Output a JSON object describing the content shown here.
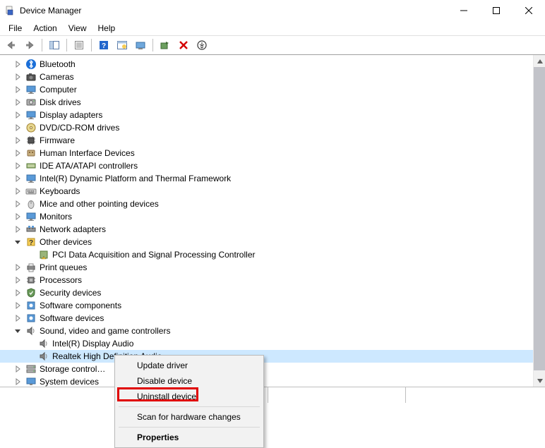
{
  "window": {
    "title": "Device Manager"
  },
  "menubar": {
    "file": "File",
    "action": "Action",
    "view": "View",
    "help": "Help"
  },
  "toolbar": {
    "back": "back",
    "forward": "forward",
    "show_hide": "show-hide-tree",
    "properties": "properties",
    "help": "help",
    "interval": "action-group",
    "monitor": "update-driver",
    "scan": "scan-hardware",
    "uninstall": "uninstall",
    "more": "more"
  },
  "tree": {
    "items": [
      {
        "label": "Bluetooth",
        "expandable": true,
        "icon": "bluetooth"
      },
      {
        "label": "Cameras",
        "expandable": true,
        "icon": "camera"
      },
      {
        "label": "Computer",
        "expandable": true,
        "icon": "monitor"
      },
      {
        "label": "Disk drives",
        "expandable": true,
        "icon": "disk"
      },
      {
        "label": "Display adapters",
        "expandable": true,
        "icon": "monitor"
      },
      {
        "label": "DVD/CD-ROM drives",
        "expandable": true,
        "icon": "optical"
      },
      {
        "label": "Firmware",
        "expandable": true,
        "icon": "chip"
      },
      {
        "label": "Human Interface Devices",
        "expandable": true,
        "icon": "hid"
      },
      {
        "label": "IDE ATA/ATAPI controllers",
        "expandable": true,
        "icon": "ide"
      },
      {
        "label": "Intel(R) Dynamic Platform and Thermal Framework",
        "expandable": true,
        "icon": "monitor"
      },
      {
        "label": "Keyboards",
        "expandable": true,
        "icon": "keyboard"
      },
      {
        "label": "Mice and other pointing devices",
        "expandable": true,
        "icon": "mouse"
      },
      {
        "label": "Monitors",
        "expandable": true,
        "icon": "monitor"
      },
      {
        "label": "Network adapters",
        "expandable": true,
        "icon": "network"
      },
      {
        "label": "Other devices",
        "expandable": true,
        "icon": "other",
        "expanded": true,
        "children": [
          {
            "label": "PCI Data Acquisition and Signal Processing Controller",
            "icon": "warn"
          }
        ]
      },
      {
        "label": "Print queues",
        "expandable": true,
        "icon": "printer"
      },
      {
        "label": "Processors",
        "expandable": true,
        "icon": "cpu"
      },
      {
        "label": "Security devices",
        "expandable": true,
        "icon": "security"
      },
      {
        "label": "Software components",
        "expandable": true,
        "icon": "software"
      },
      {
        "label": "Software devices",
        "expandable": true,
        "icon": "software"
      },
      {
        "label": "Sound, video and game controllers",
        "expandable": true,
        "icon": "sound",
        "expanded": true,
        "children": [
          {
            "label": "Intel(R) Display Audio",
            "icon": "sound"
          },
          {
            "label": "Realtek High Definition Audio",
            "icon": "sound",
            "selected": true,
            "truncateAt": 12
          }
        ]
      },
      {
        "label": "Storage controllers",
        "expandable": true,
        "icon": "storage",
        "truncate": true
      },
      {
        "label": "System devices",
        "expandable": true,
        "icon": "system",
        "truncate": true
      }
    ]
  },
  "contextMenu": {
    "updateDriver": "Update driver",
    "disableDevice": "Disable device",
    "uninstallDevice": "Uninstall device",
    "scanHardware": "Scan for hardware changes",
    "properties": "Properties"
  },
  "highlight": {
    "target": "uninstallDevice"
  }
}
